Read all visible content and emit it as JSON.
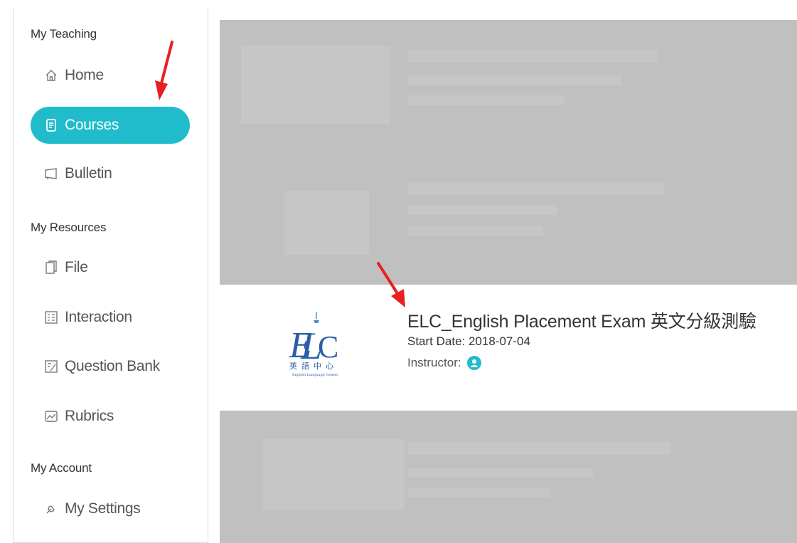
{
  "sidebar": {
    "sections": [
      {
        "title": "My Teaching"
      },
      {
        "title": "My Resources"
      },
      {
        "title": "My Account"
      }
    ],
    "items": [
      {
        "label": "Home",
        "icon": "home-icon"
      },
      {
        "label": "Courses",
        "icon": "courses-icon",
        "active": true
      },
      {
        "label": "Bulletin",
        "icon": "bulletin-icon"
      },
      {
        "label": "File",
        "icon": "file-icon"
      },
      {
        "label": "Interaction",
        "icon": "interaction-icon"
      },
      {
        "label": "Question Bank",
        "icon": "question-bank-icon"
      },
      {
        "label": "Rubrics",
        "icon": "rubrics-icon"
      },
      {
        "label": "My Settings",
        "icon": "settings-icon"
      }
    ]
  },
  "course": {
    "title": "ELC_English Placement Exam 英文分級測驗",
    "start_date": "Start Date: 2018-07-04",
    "instructor_label": "Instructor:",
    "logo_text": "ELC 英語中心 English Language Center"
  },
  "colors": {
    "accent": "#21bccb",
    "overlay": "#c0c0c0",
    "arrow": "#e8201f"
  }
}
